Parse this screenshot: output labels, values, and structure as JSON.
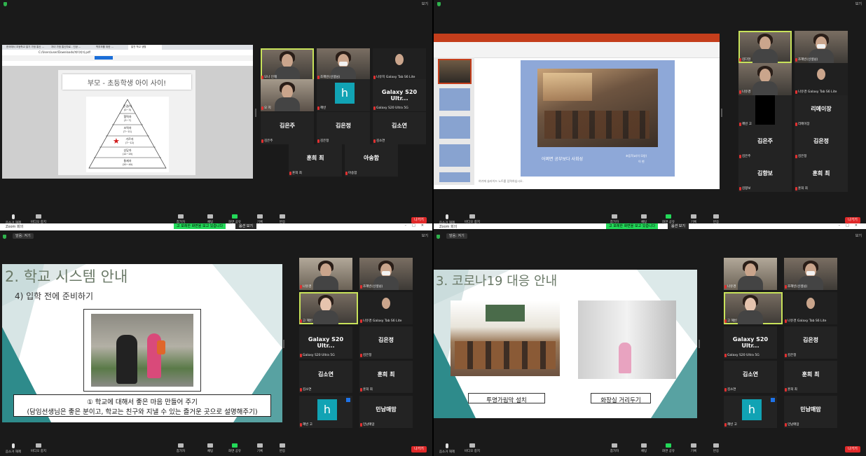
{
  "common": {
    "toolbar": {
      "mute": "음소거 해제",
      "video": "비디오 중지",
      "participants": "참가자",
      "chat": "채팅",
      "share": "화면 공유",
      "record": "기록",
      "reactions": "반응",
      "leave": "나가기"
    },
    "view_label": "보기",
    "window_title": "Zoom 회의",
    "audio_pill": "말음: 켜기",
    "share_banner": "고 포레한 화면을 보고 있습니다",
    "stop_share": "옵션 보기",
    "participant_counts": [
      "11",
      "10",
      "10",
      "10"
    ]
  },
  "q1": {
    "browser_tabs": [
      "한국에서 초등학교 알기 가정 통신 ...",
      "자녀 가정 통신자료 - 인공 ...",
      "학부모를 위한 ...",
      "알찬 학교 생활"
    ],
    "address": "C:/Users/user/Downloads/파이지자.pdf",
    "slide_title": "부모 - 초등학생 아이 사이!",
    "pyramid": [
      "존경/자",
      "협력자",
      "조력자",
      "가르자",
      "상담자",
      "통제자"
    ],
    "pyramid_ages": [
      "(0~3)",
      "(3~7)",
      "(7~11)",
      "(7~12)",
      "(12~20)",
      "(20~40)"
    ],
    "tiles": [
      {
        "big": "",
        "name": "모나 인해"
      },
      {
        "big": "",
        "name": "조혜빈(선생님)"
      },
      {
        "big": "",
        "name": "나유지 Galaxy Tab S6 Lite"
      },
      {
        "big": "",
        "name": "오 지"
      },
      {
        "big": "h",
        "name": "혜빈"
      },
      {
        "big": "Galaxy S20 Ultr...",
        "name": "Galaxy S20 Ultra 5G"
      },
      {
        "big": "김은주",
        "name": "김은주"
      },
      {
        "big": "김은정",
        "name": "김은정"
      },
      {
        "big": "김소연",
        "name": "김소연"
      },
      {
        "big": "훈희 최",
        "name": "훈희 최"
      },
      {
        "big": "아송함",
        "name": "아송함"
      }
    ]
  },
  "q2": {
    "slide_caption": "어쩌면 공부보다 사회성",
    "slide_sub1": "초등학교(이 모양)",
    "slide_sub2": "이 현",
    "notes": "여기에 슬라이드 노트를 입력하십시오.",
    "tiles": [
      {
        "big": "",
        "name": "김다현"
      },
      {
        "big": "",
        "name": "조혜빈(선생님)"
      },
      {
        "big": "",
        "name": "나유경"
      },
      {
        "big": "",
        "name": "나유경 Galaxy Tab S6 Lite"
      },
      {
        "big": "",
        "name": "혜빈 고"
      },
      {
        "big": "리메이장",
        "name": "리메이장"
      },
      {
        "big": "김은주",
        "name": "김은주"
      },
      {
        "big": "김은정",
        "name": "김은정"
      },
      {
        "big": "김향보",
        "name": "김향보"
      },
      {
        "big": "훈희 최",
        "name": "훈희 최"
      }
    ]
  },
  "q3": {
    "slide_title": "2. 학교 시스템 안내",
    "slide_sub": "4) 입학 전에 준비하기",
    "caption_line1": "① 학교에 대해서 좋은 마음 만들어 주기",
    "caption_line2": "(담임선생님은 좋은 분이고, 학교는 친구와 지낼 수 있는 즐거운 곳으로 설명해주기)",
    "tiles": [
      {
        "big": "",
        "name": "나유경"
      },
      {
        "big": "",
        "name": "조혜빈(선생님)"
      },
      {
        "big": "",
        "name": "고 혜빈"
      },
      {
        "big": "",
        "name": "나유경 Galaxy Tab S6 Lite"
      },
      {
        "big": "Galaxy S20 Ultr...",
        "name": "Galaxy S20 Ultra 5G"
      },
      {
        "big": "김은정",
        "name": "김은정"
      },
      {
        "big": "김소연",
        "name": "김소연"
      },
      {
        "big": "훈희 최",
        "name": "훈희 최"
      },
      {
        "big": "h",
        "name": "혜빈 고"
      },
      {
        "big": "민남매맘",
        "name": "민남매맘"
      }
    ]
  },
  "q4": {
    "slide_title": "3. 코로나19 대응 안내",
    "label_left": "투명가림막 설치",
    "label_right": "화장실 거리두기",
    "tiles": [
      {
        "big": "",
        "name": "나유경"
      },
      {
        "big": "",
        "name": "조혜빈(선생님)"
      },
      {
        "big": "",
        "name": "고 혜빈"
      },
      {
        "big": "",
        "name": "나유경 Galaxy Tab S6 Lite"
      },
      {
        "big": "Galaxy S20 Ultr...",
        "name": "Galaxy S20 Ultra 5G"
      },
      {
        "big": "김은정",
        "name": "김은정"
      },
      {
        "big": "김소연",
        "name": "김소연"
      },
      {
        "big": "훈희 최",
        "name": "훈희 최"
      },
      {
        "big": "h",
        "name": "혜빈 고"
      },
      {
        "big": "민남매맘",
        "name": "민남매맘"
      }
    ]
  }
}
